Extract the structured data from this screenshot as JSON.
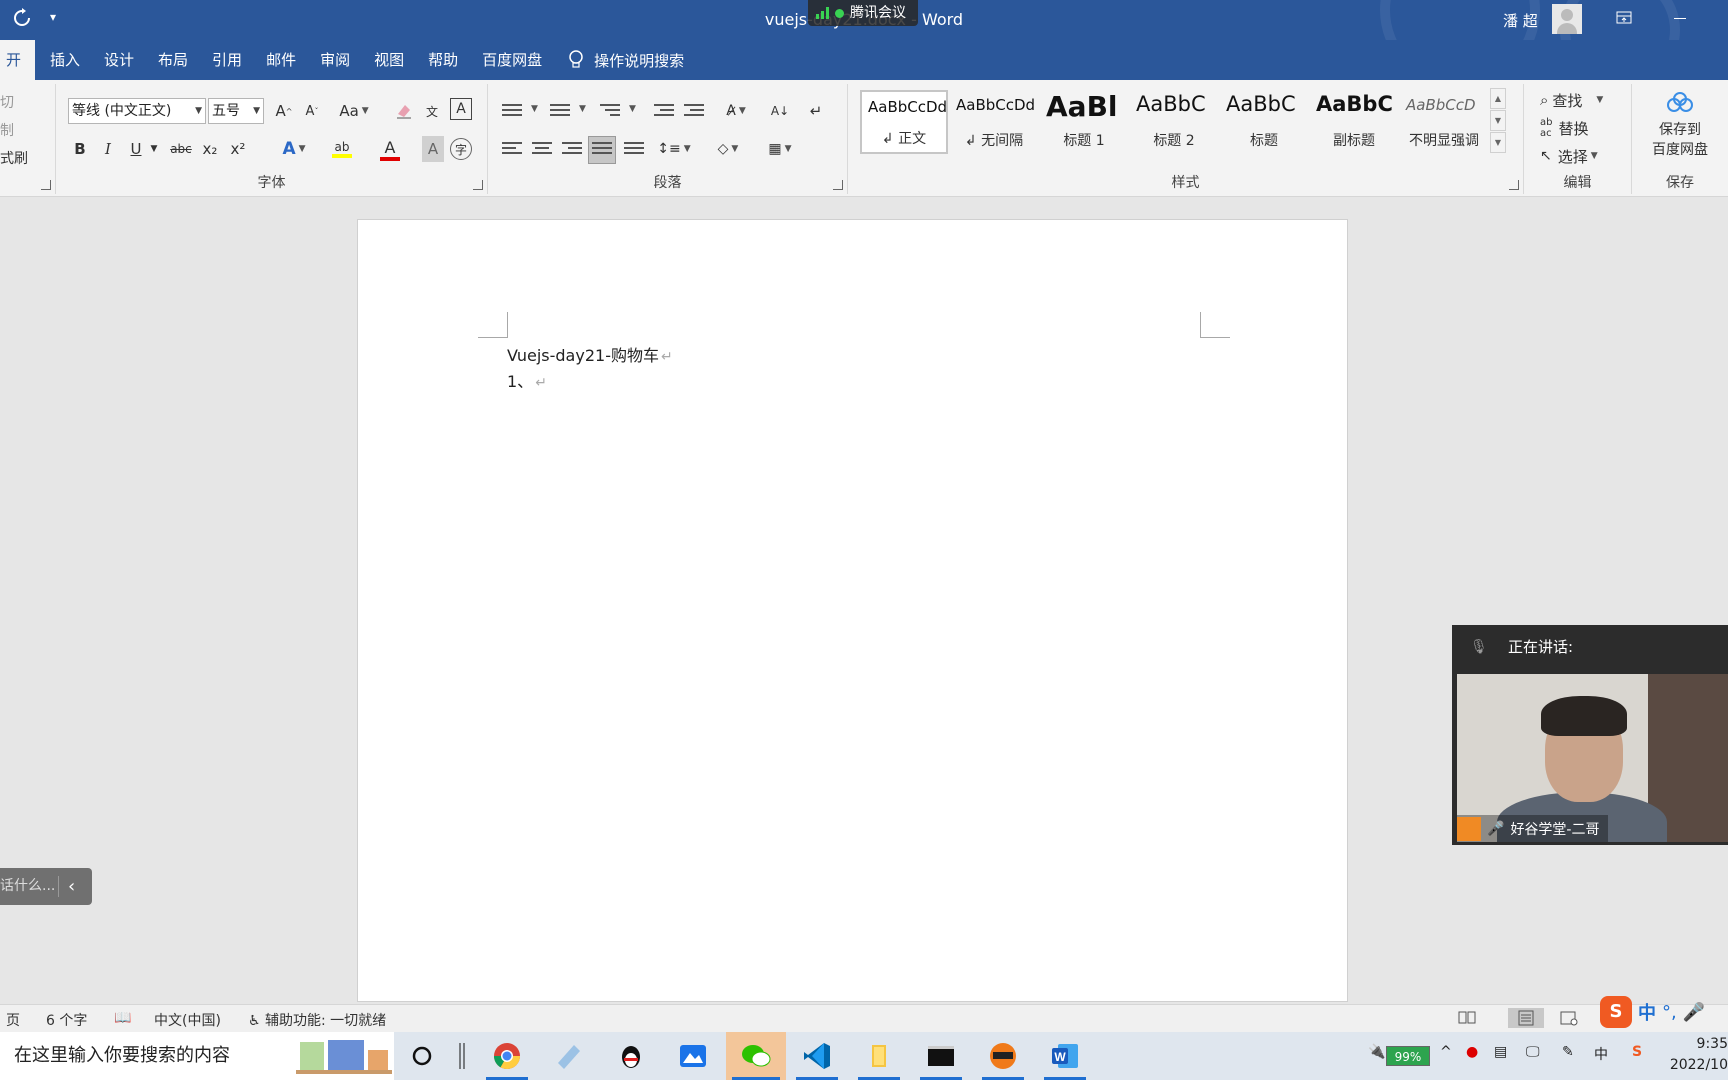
{
  "titlebar": {
    "document_title": "vuejs-day21.docx - Word",
    "meeting_label": "腾讯会议",
    "user_name": "潘 超",
    "bg_color": "#2b579a"
  },
  "tabs": {
    "active_label": "开始",
    "items": [
      "插入",
      "设计",
      "布局",
      "引用",
      "邮件",
      "审阅",
      "视图",
      "帮助",
      "百度网盘"
    ],
    "tell_me": "操作说明搜索"
  },
  "clipboard": {
    "cut": "剪切",
    "copy": "复制",
    "format_painter": "格式刷"
  },
  "font": {
    "label": "字体",
    "font_name": "等线 (中文正文)",
    "font_size": "五号",
    "aa_label": "Aa",
    "bold": "B",
    "italic": "I",
    "underline": "U",
    "strike": "abc",
    "subscript": "x₂",
    "superscript": "x²",
    "font_color": "#e00000",
    "highlight_color": "#ffff00"
  },
  "paragraph": {
    "label": "段落"
  },
  "styles": {
    "label": "样式",
    "items": [
      {
        "sample": "AaBbCcDd",
        "name": "↲ 正文"
      },
      {
        "sample": "AaBbCcDd",
        "name": "↲ 无间隔"
      },
      {
        "sample": "AaBl",
        "name": "标题 1"
      },
      {
        "sample": "AaBbC",
        "name": "标题 2"
      },
      {
        "sample": "AaBbC",
        "name": "标题"
      },
      {
        "sample": "AaBbC",
        "name": "副标题"
      },
      {
        "sample": "AaBbCcD",
        "name": "不明显强调"
      }
    ]
  },
  "editing": {
    "label": "编辑",
    "find": "查找",
    "replace": "替换",
    "select": "选择"
  },
  "save": {
    "label": "保存",
    "save_to_line1": "保存到",
    "save_to_line2": "百度网盘"
  },
  "document": {
    "line1": "Vuejs-day21-购物车",
    "line2": "1、",
    "para_mark": "↵"
  },
  "tellme_float": {
    "text": "话什么..."
  },
  "video": {
    "header": "正在讲话:",
    "caption": "好谷学堂-二哥"
  },
  "statusbar": {
    "page": "页",
    "word_count": "6 个字",
    "language": "中文(中国)",
    "accessibility": "辅助功能: 一切就绪"
  },
  "taskbar": {
    "search_placeholder": "在这里输入你要搜索的内容",
    "battery": "99%",
    "ime": "中",
    "time": "9:35",
    "date": "2022/10"
  }
}
